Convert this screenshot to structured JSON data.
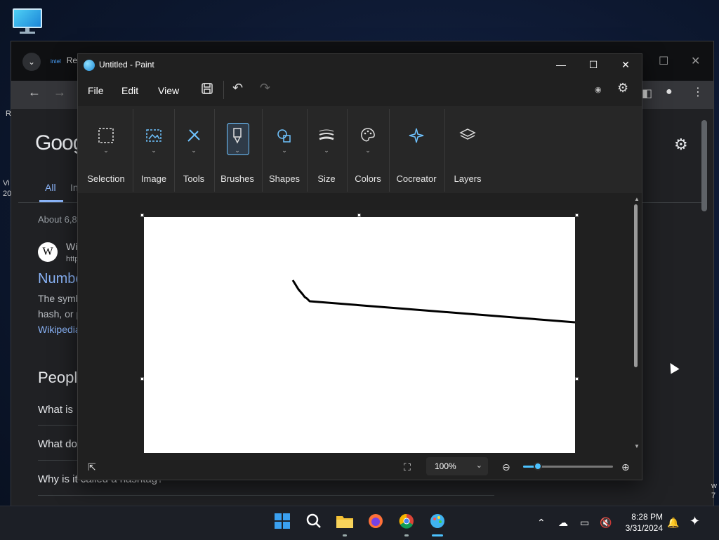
{
  "chrome": {
    "tab_partial": "Re",
    "tab_intel": "intel",
    "google_logo_partial": "Goog",
    "tab_all": "All",
    "tab_i": "In",
    "about_partial": "About 6,8",
    "wiki_name_partial": "Wi",
    "wiki_url_partial": "http",
    "result_title_partial": "Numbe",
    "snippet_line1": "The symb",
    "snippet_line2": "hash, or p",
    "snippet_link": "Wikipedia",
    "people_partial": "People",
    "paa": [
      "What is",
      "What do",
      "Why is it called a hashtag?"
    ],
    "left_edge_text": [
      "R",
      "Vi",
      "20"
    ],
    "right_edge_text": [
      "w",
      "7"
    ]
  },
  "paint": {
    "title": "Untitled - Paint",
    "menus": [
      "File",
      "Edit",
      "View"
    ],
    "ribbon": [
      {
        "label": "Selection",
        "icon": "selection-icon"
      },
      {
        "label": "Image",
        "icon": "image-icon"
      },
      {
        "label": "Tools",
        "icon": "tools-icon"
      },
      {
        "label": "Brushes",
        "icon": "brushes-icon"
      },
      {
        "label": "Shapes",
        "icon": "shapes-icon"
      },
      {
        "label": "Size",
        "icon": "size-icon"
      },
      {
        "label": "Colors",
        "icon": "colors-icon"
      },
      {
        "label": "Cocreator",
        "icon": "cocreator-icon"
      },
      {
        "label": "Layers",
        "icon": "layers-icon"
      }
    ],
    "zoom": "100%"
  },
  "taskbar": {
    "time": "8:28 PM",
    "date": "3/31/2024",
    "apps": [
      "start-icon",
      "search-icon",
      "file-explorer-icon",
      "firefox-icon",
      "chrome-icon",
      "paint-icon"
    ]
  },
  "colors": {
    "accent": "#4cc2ff",
    "link": "#8ab4f8"
  }
}
